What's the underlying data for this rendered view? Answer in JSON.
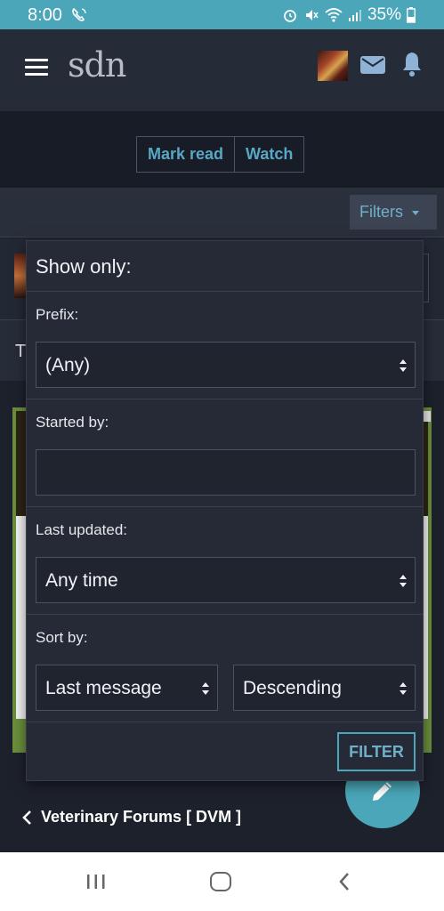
{
  "status_bar": {
    "time": "8:00",
    "battery": "35%"
  },
  "header": {
    "logo": "sdn"
  },
  "toolbar": {
    "mark_read": "Mark read",
    "watch": "Watch",
    "filters": "Filters"
  },
  "background": {
    "row_letter": "T"
  },
  "filter_menu": {
    "title": "Show only:",
    "prefix_label": "Prefix:",
    "prefix_value": "(Any)",
    "started_by_label": "Started by:",
    "started_by_value": "",
    "last_updated_label": "Last updated:",
    "last_updated_value": "Any time",
    "sort_by_label": "Sort by:",
    "sort_field_value": "Last message",
    "sort_order_value": "Descending",
    "submit": "FILTER"
  },
  "breadcrumb": {
    "label": "Veterinary Forums [ DVM ]"
  },
  "colors": {
    "accent": "#4aa6b8",
    "link": "#58a8c5",
    "background": "#1b1f2a"
  },
  "icons": [
    "menu-icon",
    "mail-icon",
    "bell-icon",
    "pencil-icon",
    "chevron-left-icon",
    "updown-icon"
  ]
}
